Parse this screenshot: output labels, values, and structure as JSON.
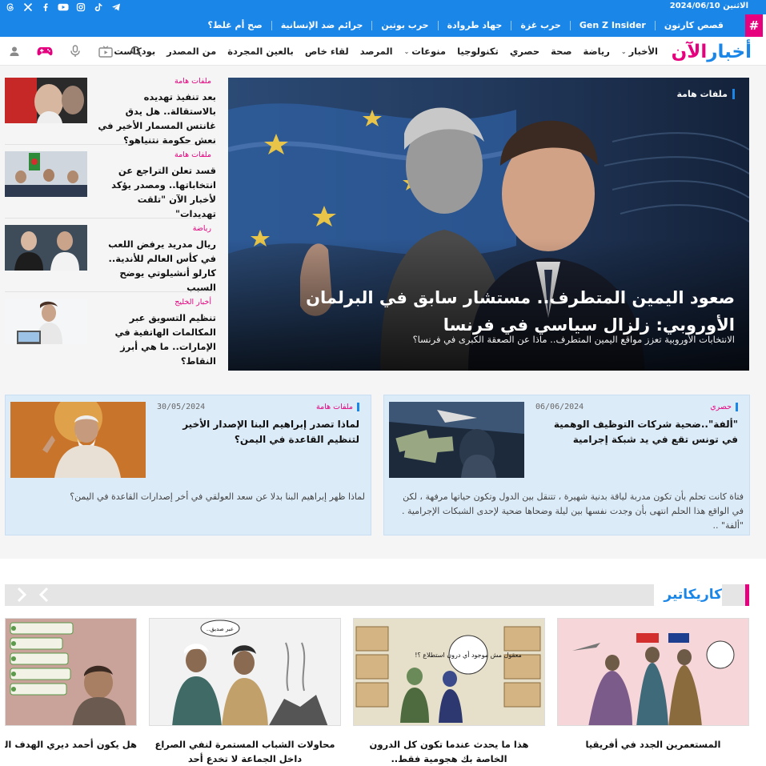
{
  "topbar": {
    "date": "الاثنين 2024/06/10"
  },
  "trending": [
    "قصص كارتون",
    "Gen Z Insider",
    "حرب غزة",
    "جهاد طروادة",
    "حرب بوتين",
    "جرائم ضد الإنسانية",
    "صح أم غلط؟"
  ],
  "logo": {
    "part1": "أخبار",
    "part2": "الآن"
  },
  "nav": [
    {
      "label": "الأخبار",
      "dropdown": true
    },
    {
      "label": "رياضة",
      "dropdown": false
    },
    {
      "label": "صحة",
      "dropdown": false
    },
    {
      "label": "حصري",
      "dropdown": false
    },
    {
      "label": "تكنولوجيا",
      "dropdown": false
    },
    {
      "label": "منوعات",
      "dropdown": true
    },
    {
      "label": "المرصد",
      "dropdown": false
    },
    {
      "label": "لقاء خاص",
      "dropdown": false
    },
    {
      "label": "بالعين المجردة",
      "dropdown": false
    },
    {
      "label": "من المصدر",
      "dropdown": false
    },
    {
      "label": "بودكاست",
      "dropdown": false
    }
  ],
  "hero": {
    "category": "ملفات هامة",
    "title": "صعود اليمين المتطرف.. مستشار سابق في البرلمان الأوروبي: زلزال سياسي في فرنسا",
    "subtitle": "الانتخابات الأوروبية تعزز مواقع اليمين المتطرف.. ماذا عن الصعقة الكبرى في فرنسا؟"
  },
  "side": [
    {
      "category": "ملفات هامة",
      "title": "بعد تنفيذ تهديده بالاستقالة.. هل يدق غانتس المسمار الأخير في نعش حكومة نتنياهو؟"
    },
    {
      "category": "ملفات هامة",
      "title": "قسد تعلن التراجع عن انتخاباتها.. ومصدر يؤكد لأخبار الآن \"تلقت تهديدات\""
    },
    {
      "category": "رياضة",
      "title": "ريال مدريد يرفض اللعب في كأس العالم للأندية.. كارلو أنشيلوتي يوضح السبب"
    },
    {
      "category": "أخبار الخليج",
      "title": "تنظيم التسويق عبر المكالمات الهاتفية في الإمارات.. ما هي أبرز النقاط؟"
    }
  ],
  "cards": [
    {
      "category": "حصري",
      "date": "06/06/2024",
      "title": "\"ألفة\"..ضحية شركات التوظيف الوهمية في تونس تقع في يد شبكة إجرامية",
      "excerpt": "فتاة كانت تحلم بأن تكون مدربة لياقة بدنية شهيرة ، تتنقل بين الدول وتكون حياتها مرفهة ، لكن في الواقع هذا الحلم انتهى بأن وجدت نفسها بين ليلة وضحاها ضحية لإحدى الشبكات الإجرامية . \"ألفة\" .."
    },
    {
      "category": "ملفات هامة",
      "date": "30/05/2024",
      "title": "لماذا تصدر إبراهيم البنا الإصدار الأخير لتنظيم القاعدة في اليمن؟",
      "excerpt": "لماذا ظهر إبراهيم البنا بدلا عن سعد العولقي في أخر إصدارات القاعدة في اليمن؟"
    }
  ],
  "caricature": {
    "heading": "كاريكاتير",
    "items": [
      {
        "title": "المستعمرين الجدد في أفريقيا"
      },
      {
        "title": "هذا ما يحدث عندما تكون كل الدرون الخاصة بك هجومية فقط.."
      },
      {
        "title": "محاولات الشباب المستمرة لنفي الصراع داخل الجماعة لا تخدع أحد"
      },
      {
        "title": "هل يكون أحمد ديري الهدف القادم"
      }
    ],
    "cartoon_texts": {
      "c2_bubble": "معقول مش موجود أي درون استطلاع ؟!",
      "c3_bubble": "عبر صديق.."
    }
  },
  "colors": {
    "brand_blue": "#1a86e8",
    "accent_pink": "#e6007e",
    "card_bg": "#dcebf8"
  }
}
